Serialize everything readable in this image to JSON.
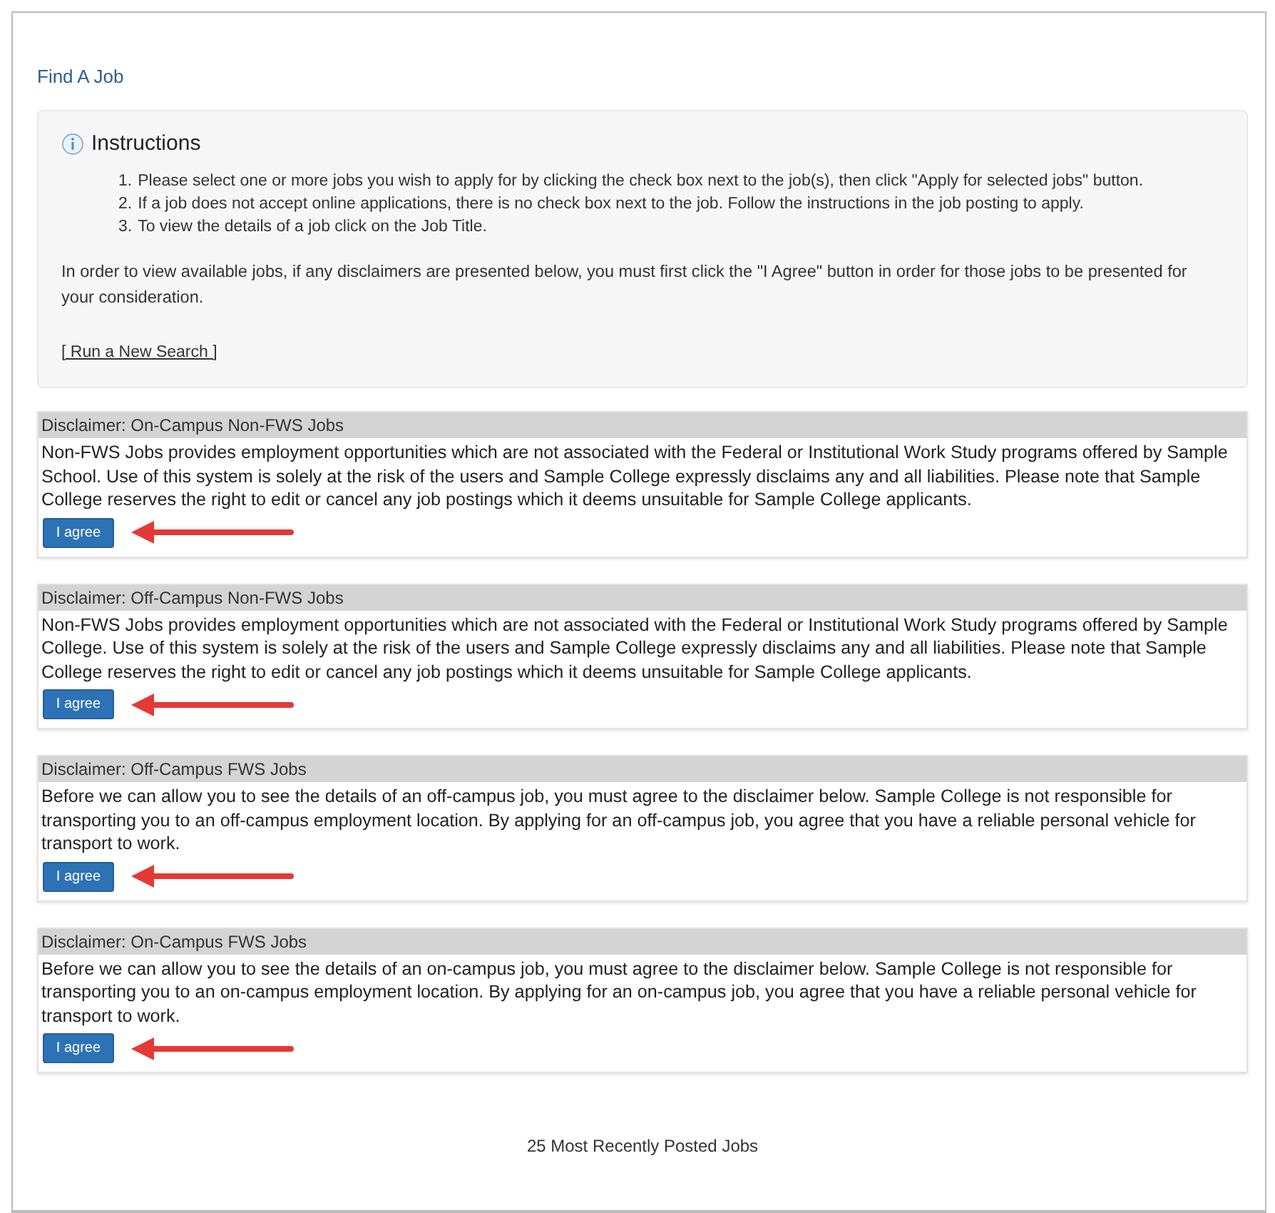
{
  "page_title": "Find A Job",
  "instructions": {
    "title": "Instructions",
    "steps": [
      {
        "marker": "1.",
        "text": "Please select one or more jobs you wish to apply for by clicking the check box next to the job(s), then click \"Apply for selected jobs\" button."
      },
      {
        "marker": "2.",
        "text": "If a job does not accept online applications, there is no check box next to the job. Follow the instructions in the job posting to apply."
      },
      {
        "marker": "3.",
        "text": "To view the details of a job click on the Job Title."
      }
    ],
    "note": "In order to view available jobs, if any disclaimers are presented below, you must first click the \"I Agree\" button in order for those jobs to be presented for your consideration.",
    "link": "[ Run a New Search ]"
  },
  "disclaimers": [
    {
      "title": "Disclaimer: On-Campus Non-FWS Jobs",
      "text": "Non-FWS Jobs provides employment opportunities which are not associated with the Federal or Institutional Work Study programs offered by Sample School. Use of this system is solely at the risk of the users and Sample College expressly disclaims any and all liabilities. Please note that Sample College reserves the right to edit or cancel any job postings which it deems unsuitable for Sample College applicants.",
      "button": "I agree"
    },
    {
      "title": "Disclaimer: Off-Campus Non-FWS Jobs",
      "text": "Non-FWS Jobs provides employment opportunities which are not associated with the Federal or Institutional Work Study programs offered by Sample College. Use of this system is solely at the risk of the users and Sample College expressly disclaims any and all liabilities. Please note that Sample College reserves the right to edit or cancel any job postings which it deems unsuitable for Sample College applicants.",
      "button": "I agree"
    },
    {
      "title": "Disclaimer: Off-Campus FWS Jobs",
      "text": "Before we can allow you to see the details of an off-campus job, you must agree to the disclaimer below. Sample College is not responsible for transporting you to an off-campus employment location. By applying for an off-campus job, you agree that you have a reliable personal vehicle for transport to work.",
      "button": "I agree"
    },
    {
      "title": "Disclaimer: On-Campus FWS Jobs",
      "text": "Before we can allow you to see the details of an on-campus job, you must agree to the disclaimer below. Sample College is not responsible for transporting you to an on-campus employment location. By applying for an on-campus job, you agree that you have a reliable personal vehicle for transport to work.",
      "button": "I agree"
    }
  ],
  "footer": "25 Most Recently Posted Jobs"
}
